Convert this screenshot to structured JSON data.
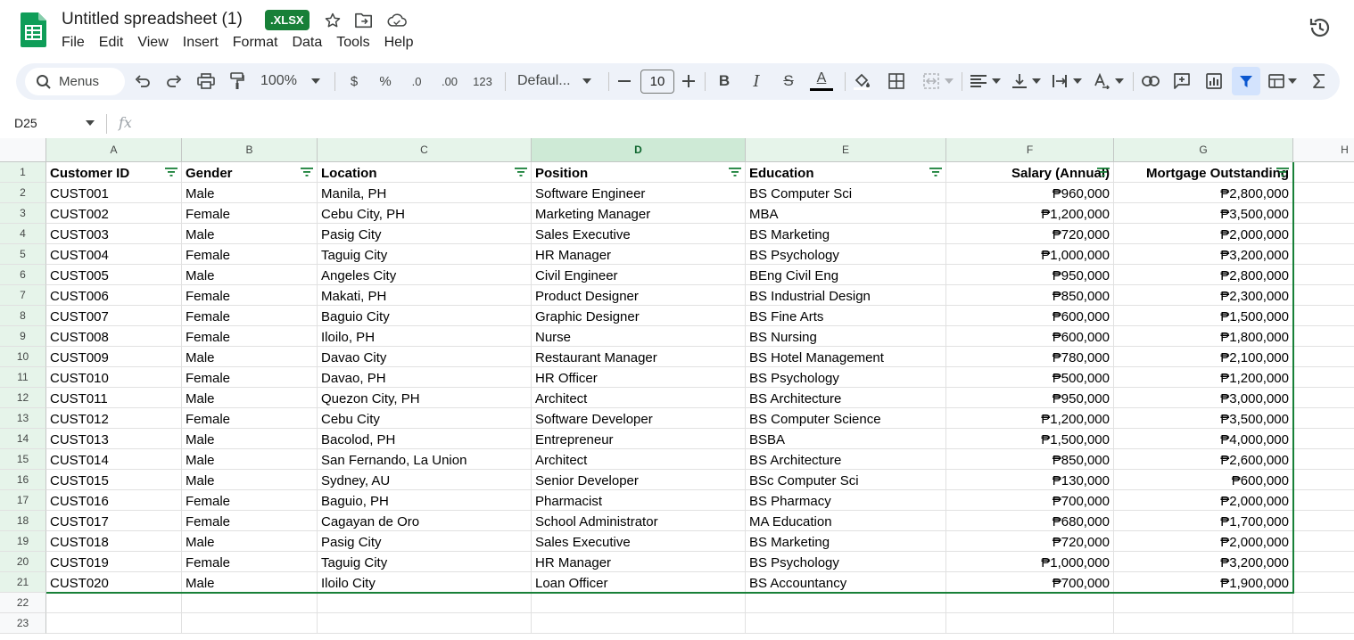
{
  "app": {
    "title": "Untitled spreadsheet (1)",
    "file_badge": ".XLSX",
    "menus": [
      "File",
      "Edit",
      "View",
      "Insert",
      "Format",
      "Data",
      "Tools",
      "Help"
    ]
  },
  "toolbar": {
    "search_label": "Menus",
    "zoom": "100%",
    "currency": "$",
    "percent": "%",
    "decrease_decimal": ".0",
    "increase_decimal": ".00",
    "number_format": "123",
    "font": "Defaul...",
    "font_size": "10",
    "bold": "B",
    "italic": "I",
    "strikethrough": "S",
    "text_color": "A"
  },
  "formula_bar": {
    "cell_ref": "D25",
    "fx": "fx",
    "value": ""
  },
  "colors": {
    "accent_green": "#188038",
    "selection_blue": "#d3e3fd",
    "header_tint": "#e6f4ea"
  },
  "sheet": {
    "columns": [
      "A",
      "B",
      "C",
      "D",
      "E",
      "F",
      "G",
      "H"
    ],
    "rows": [
      "1",
      "2",
      "3",
      "4",
      "5",
      "6",
      "7",
      "8",
      "9",
      "10",
      "11",
      "12",
      "13",
      "14",
      "15",
      "16",
      "17",
      "18",
      "19",
      "20",
      "21",
      "22",
      "23"
    ],
    "headers": [
      "Customer ID",
      "Gender",
      "Location",
      "Position",
      "Education",
      "Salary (Annual)",
      "Mortgage Outstanding"
    ],
    "data": [
      [
        "CUST001",
        "Male",
        "Manila, PH",
        "Software Engineer",
        "BS Computer Sci",
        "₱960,000",
        "₱2,800,000"
      ],
      [
        "CUST002",
        "Female",
        "Cebu City, PH",
        "Marketing Manager",
        "MBA",
        "₱1,200,000",
        "₱3,500,000"
      ],
      [
        "CUST003",
        "Male",
        "Pasig City",
        "Sales Executive",
        "BS Marketing",
        "₱720,000",
        "₱2,000,000"
      ],
      [
        "CUST004",
        "Female",
        "Taguig City",
        "HR Manager",
        "BS Psychology",
        "₱1,000,000",
        "₱3,200,000"
      ],
      [
        "CUST005",
        "Male",
        "Angeles City",
        "Civil Engineer",
        "BEng Civil Eng",
        "₱950,000",
        "₱2,800,000"
      ],
      [
        "CUST006",
        "Female",
        "Makati, PH",
        "Product Designer",
        "BS Industrial Design",
        "₱850,000",
        "₱2,300,000"
      ],
      [
        "CUST007",
        "Female",
        "Baguio City",
        "Graphic Designer",
        "BS Fine Arts",
        "₱600,000",
        "₱1,500,000"
      ],
      [
        "CUST008",
        "Female",
        "Iloilo, PH",
        "Nurse",
        "BS Nursing",
        "₱600,000",
        "₱1,800,000"
      ],
      [
        "CUST009",
        "Male",
        "Davao City",
        "Restaurant Manager",
        "BS Hotel Management",
        "₱780,000",
        "₱2,100,000"
      ],
      [
        "CUST010",
        "Female",
        "Davao, PH",
        "HR Officer",
        "BS Psychology",
        "₱500,000",
        "₱1,200,000"
      ],
      [
        "CUST011",
        "Male",
        "Quezon City, PH",
        "Architect",
        "BS Architecture",
        "₱950,000",
        "₱3,000,000"
      ],
      [
        "CUST012",
        "Female",
        "Cebu City",
        "Software Developer",
        "BS Computer Science",
        "₱1,200,000",
        "₱3,500,000"
      ],
      [
        "CUST013",
        "Male",
        "Bacolod, PH",
        "Entrepreneur",
        "BSBA",
        "₱1,500,000",
        "₱4,000,000"
      ],
      [
        "CUST014",
        "Male",
        "San Fernando, La Union",
        "Architect",
        "BS Architecture",
        "₱850,000",
        "₱2,600,000"
      ],
      [
        "CUST015",
        "Male",
        "Sydney, AU",
        "Senior Developer",
        "BSc Computer Sci",
        "₱130,000",
        "₱600,000"
      ],
      [
        "CUST016",
        "Female",
        "Baguio, PH",
        "Pharmacist",
        "BS Pharmacy",
        "₱700,000",
        "₱2,000,000"
      ],
      [
        "CUST017",
        "Female",
        "Cagayan de Oro",
        "School Administrator",
        "MA Education",
        "₱680,000",
        "₱1,700,000"
      ],
      [
        "CUST018",
        "Male",
        "Pasig City",
        "Sales Executive",
        "BS Marketing",
        "₱720,000",
        "₱2,000,000"
      ],
      [
        "CUST019",
        "Female",
        "Taguig City",
        "HR Manager",
        "BS Psychology",
        "₱1,000,000",
        "₱3,200,000"
      ],
      [
        "CUST020",
        "Male",
        "Iloilo City",
        "Loan Officer",
        "BS Accountancy",
        "₱700,000",
        "₱1,900,000"
      ]
    ]
  }
}
